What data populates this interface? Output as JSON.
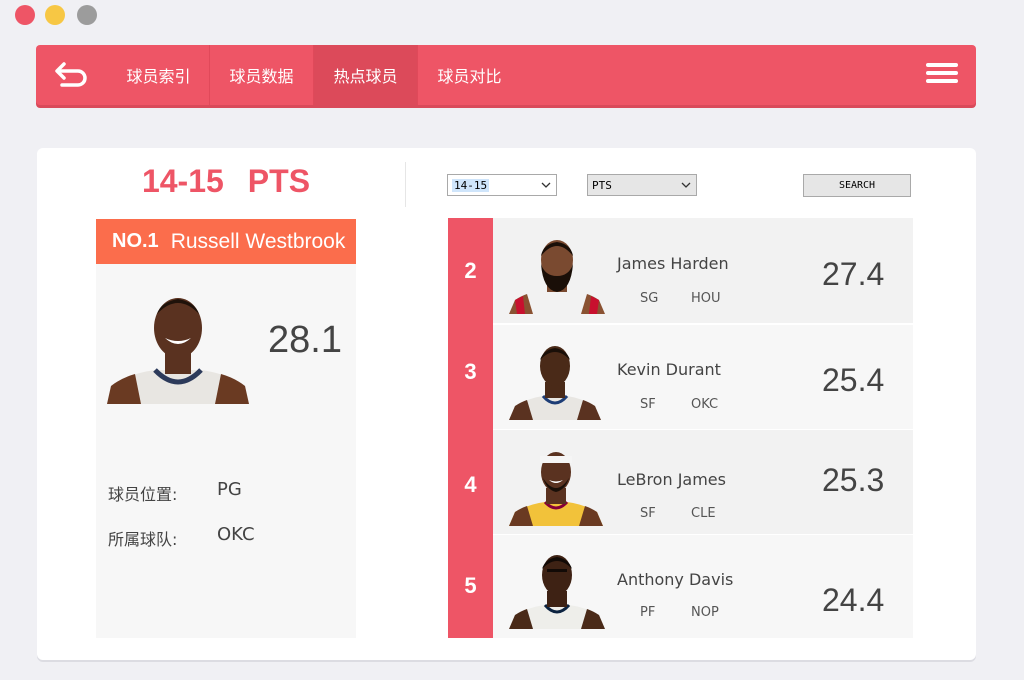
{
  "window": {
    "controls": [
      "close",
      "minimize",
      "zoom"
    ]
  },
  "nav": {
    "back_icon": "back-arrow-icon",
    "tabs": [
      {
        "label": "球员索引",
        "active": false
      },
      {
        "label": "球员数据",
        "active": false
      },
      {
        "label": "热点球员",
        "active": true
      },
      {
        "label": "球员对比",
        "active": false
      }
    ],
    "menu_icon": "hamburger-icon"
  },
  "header": {
    "season": "14-15",
    "stat": "PTS"
  },
  "top_player": {
    "rank_label": "NO.1",
    "name": "Russell Westbrook",
    "value": "28.1",
    "position_label": "球员位置:",
    "position": "PG",
    "team_label": "所属球队:",
    "team": "OKC"
  },
  "filters": {
    "season_selected": "14-15",
    "stat_selected": "PTS",
    "search_label": "SEARCH"
  },
  "ranking": [
    {
      "rank": "2",
      "name": "James Harden",
      "pos": "SG",
      "team": "HOU",
      "value": "27.4"
    },
    {
      "rank": "3",
      "name": "Kevin Durant",
      "pos": "SF",
      "team": "OKC",
      "value": "25.4"
    },
    {
      "rank": "4",
      "name": "LeBron James",
      "pos": "SF",
      "team": "CLE",
      "value": "25.3"
    },
    {
      "rank": "5",
      "name": "Anthony Davis",
      "pos": "PF",
      "team": "NOP",
      "value": "24.4"
    }
  ],
  "colors": {
    "accent": "#ee5566",
    "orange": "#fb6d4c"
  }
}
